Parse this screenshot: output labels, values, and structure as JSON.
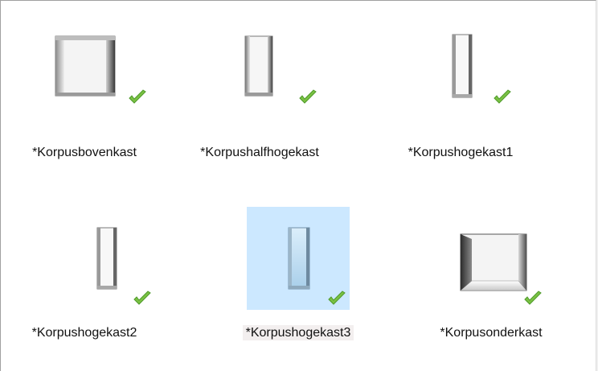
{
  "items": [
    {
      "label": "*Korpusbovenkast",
      "shape": "wide-upper",
      "checked": true,
      "selected": false
    },
    {
      "label": "*Korpushalfhogekast",
      "shape": "medium-tall",
      "checked": true,
      "selected": false
    },
    {
      "label": "*Korpushogekast1",
      "shape": "narrow-tall",
      "checked": true,
      "selected": false
    },
    {
      "label": "*Korpushogekast2",
      "shape": "narrow-tall",
      "checked": true,
      "selected": false
    },
    {
      "label": "*Korpushogekast3",
      "shape": "narrow-tall",
      "checked": true,
      "selected": true
    },
    {
      "label": "*Korpusonderkast",
      "shape": "wide-lower",
      "checked": true,
      "selected": false
    }
  ],
  "colors": {
    "selection": "#cce8ff",
    "check": "#7ac143"
  },
  "icons": {
    "status": "green-checkmark-icon",
    "thumbnail": "cabinet-carcass-icon"
  }
}
